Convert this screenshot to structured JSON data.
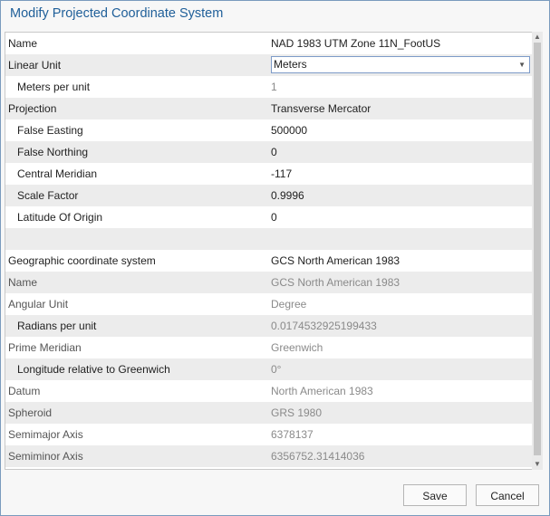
{
  "dialog": {
    "title": "Modify Projected Coordinate System",
    "rows": [
      {
        "name": "Name",
        "value": "NAD 1983 UTM Zone 11N_FootUS"
      },
      {
        "name": "Linear Unit",
        "value": "Meters"
      },
      {
        "name": "Meters per unit",
        "value": "1"
      },
      {
        "name": "Projection",
        "value": "Transverse Mercator"
      },
      {
        "name": "False Easting",
        "value": "500000"
      },
      {
        "name": "False Northing",
        "value": "0"
      },
      {
        "name": "Central Meridian",
        "value": "-117"
      },
      {
        "name": "Scale Factor",
        "value": "0.9996"
      },
      {
        "name": "Latitude Of Origin",
        "value": "0"
      },
      {
        "name": "",
        "value": ""
      },
      {
        "name": "Geographic coordinate system",
        "value": "GCS North American 1983"
      },
      {
        "name": "Name",
        "value": "GCS North American 1983"
      },
      {
        "name": "Angular Unit",
        "value": "Degree"
      },
      {
        "name": "Radians per unit",
        "value": "0.0174532925199433"
      },
      {
        "name": "Prime Meridian",
        "value": "Greenwich"
      },
      {
        "name": "Longitude relative to Greenwich",
        "value": "0°"
      },
      {
        "name": "Datum",
        "value": "North American 1983"
      },
      {
        "name": "Spheroid",
        "value": "GRS 1980"
      },
      {
        "name": "Semimajor Axis",
        "value": "6378137"
      },
      {
        "name": "Semiminor Axis",
        "value": "6356752.31414036"
      }
    ],
    "save_label": "Save",
    "cancel_label": "Cancel",
    "icons": {
      "dropdown": "chevron-down-icon",
      "scroll_up": "scroll-up-icon",
      "scroll_down": "scroll-down-icon"
    }
  }
}
